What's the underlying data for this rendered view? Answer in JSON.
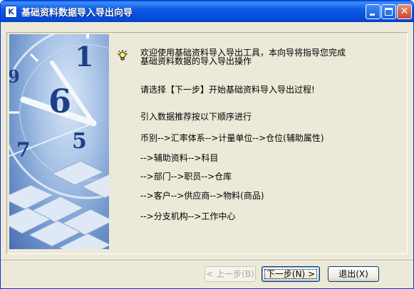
{
  "window": {
    "title": "基础资料数据导入导出向导",
    "app_icon_letter": "K"
  },
  "intro": {
    "line1": "欢迎使用基础资料导入导出工具，本向导将指导您完成",
    "line2": "基础资料数据的导入导出操作",
    "icon": "lightbulb-icon"
  },
  "instruction": "请选择【下一步】开始基础资料导入导出过程!",
  "order_title": "引入数据推荐按以下顺序进行",
  "order_steps": [
    "币别-->汇率体系-->计量单位-->仓位(辅助属性)",
    "-->辅助资料-->科目",
    "-->部门-->职员-->仓库",
    "-->客户-->供应商-->物料(商品)",
    "-->分支机构-->工作中心"
  ],
  "buttons": {
    "back_label": "< 上一步(B)",
    "next_label": "下一步(N) >",
    "exit_label": "退出(X)"
  },
  "colors": {
    "titlebar": "#0449d8",
    "window_bg": "#ece9d8",
    "close_button": "#c9472b"
  }
}
